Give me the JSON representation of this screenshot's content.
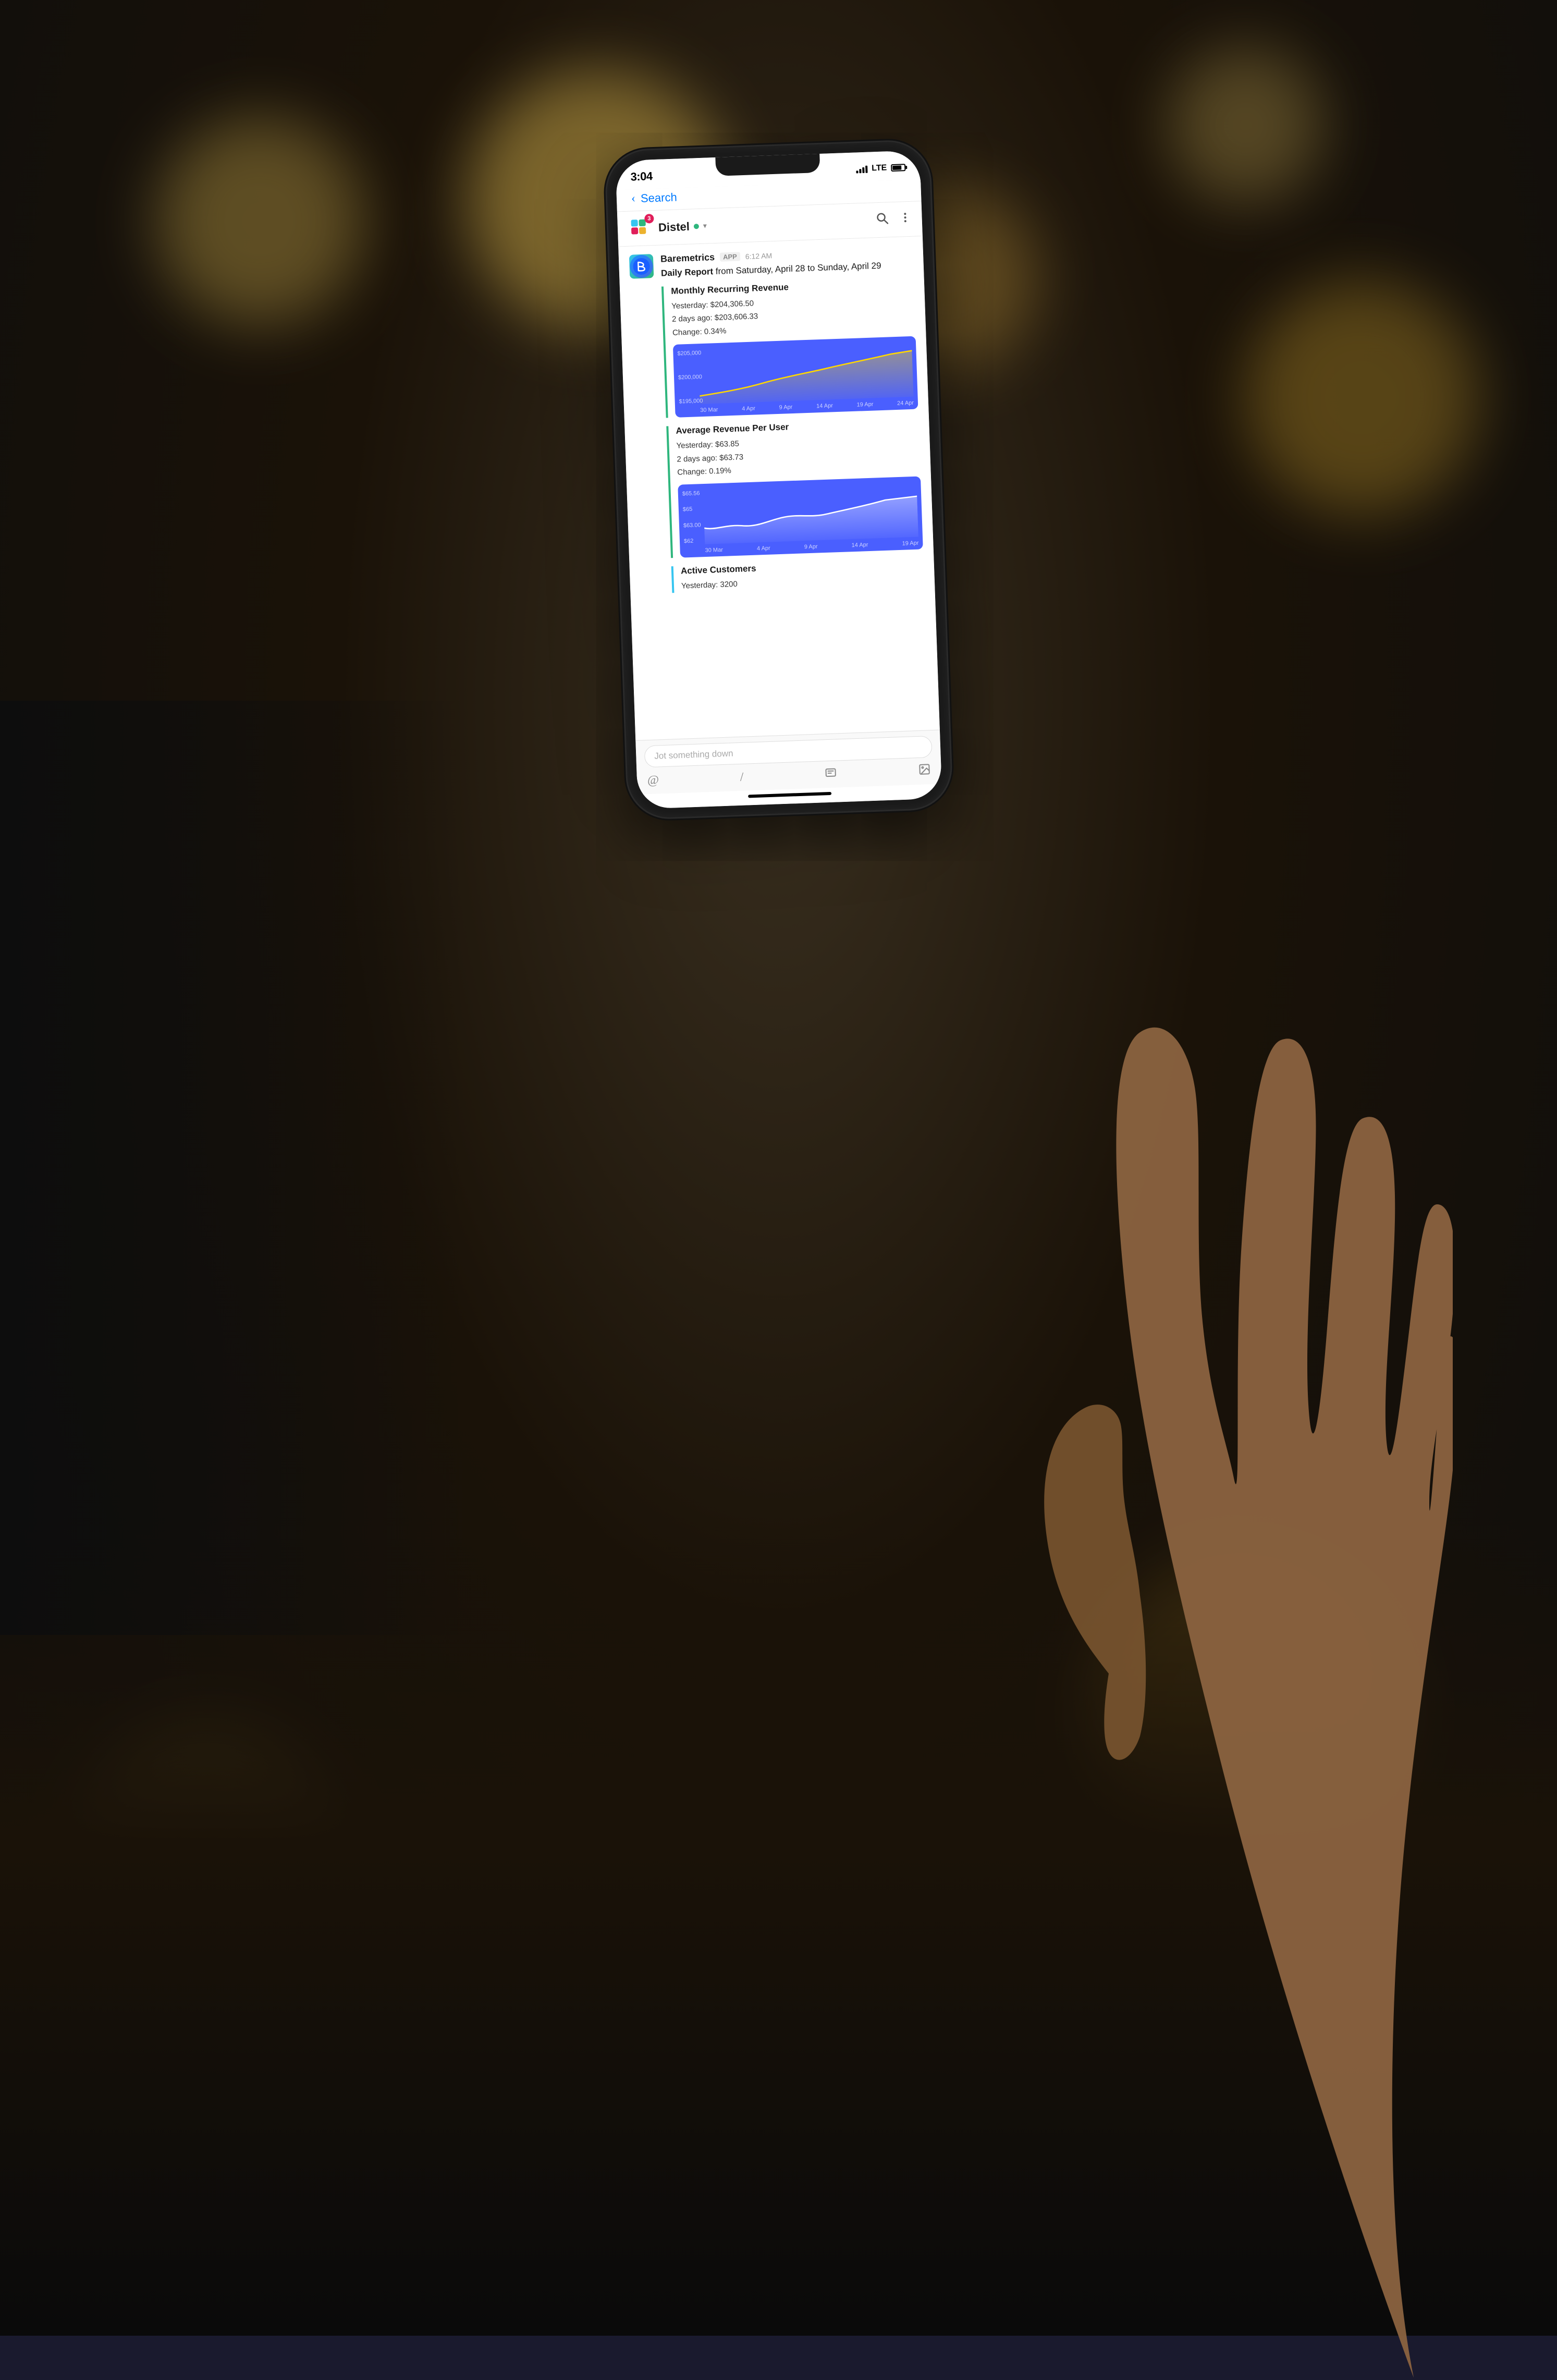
{
  "background": {
    "color": "#1a1208"
  },
  "status_bar": {
    "time": "3:04",
    "signal_label": "LTE",
    "search_label": "Search"
  },
  "channel_header": {
    "channel_name": "Distel",
    "online_indicator": "●",
    "notification_count": "3"
  },
  "message": {
    "sender": "Baremetrics",
    "app_badge": "APP",
    "time": "6:12 AM",
    "intro": "Daily Report",
    "date_range": "from Saturday, April 28 to Sunday, April 29"
  },
  "metrics": {
    "mrr": {
      "title": "Monthly Recurring Revenue",
      "yesterday_label": "Yesterday:",
      "yesterday_value": "$204,306.50",
      "two_days_label": "2 days ago:",
      "two_days_value": "$203,606.33",
      "change_label": "Change:",
      "change_value": "0.34%",
      "chart_y_labels": [
        "$205,000",
        "$200,000",
        "$195,000"
      ],
      "chart_x_labels": [
        "30 Mar",
        "4 Apr",
        "9 Apr",
        "14 Apr",
        "19 Apr",
        "24 Apr"
      ]
    },
    "arpu": {
      "title": "Average Revenue Per User",
      "yesterday_label": "Yesterday:",
      "yesterday_value": "$63.85",
      "two_days_label": "2 days ago:",
      "two_days_value": "$63.73",
      "change_label": "Change:",
      "change_value": "0.19%",
      "chart_y_labels": [
        "$65.56",
        "$65",
        "$63.00",
        "$62"
      ],
      "chart_x_labels": [
        "30 Mar",
        "4 Apr",
        "9 Apr",
        "14 Apr",
        "19 Apr"
      ]
    },
    "active_customers": {
      "title": "Active Customers",
      "yesterday_label": "Yesterday:",
      "yesterday_value": "3200"
    }
  },
  "input": {
    "placeholder": "Jot something down"
  }
}
